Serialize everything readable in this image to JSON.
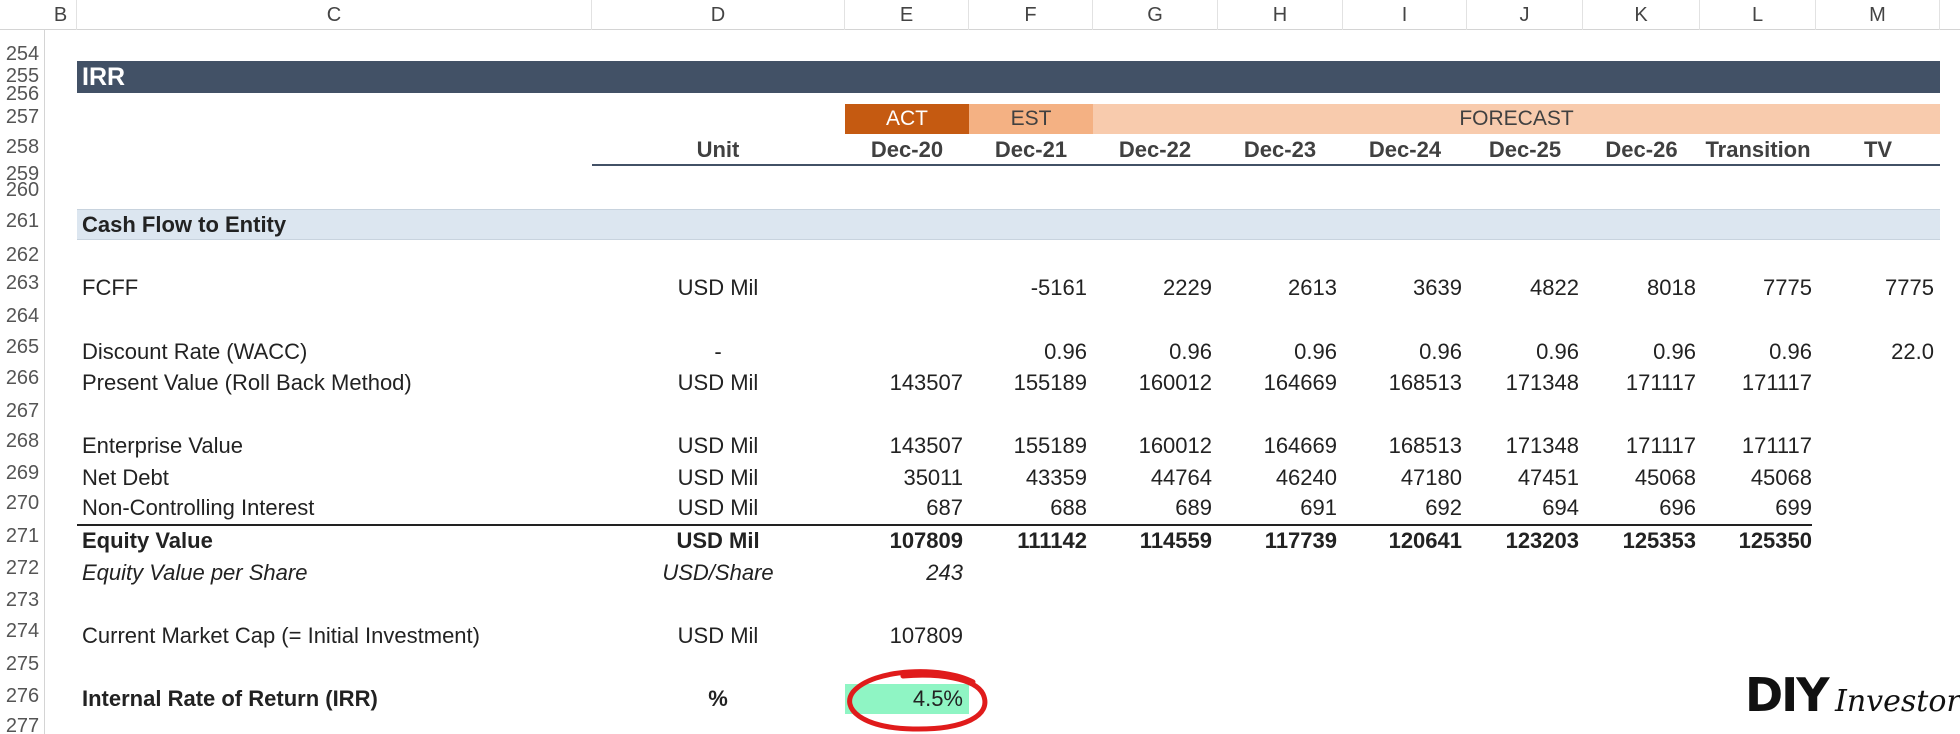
{
  "columns": [
    "B",
    "C",
    "D",
    "E",
    "F",
    "G",
    "H",
    "I",
    "J",
    "K",
    "L",
    "M"
  ],
  "rows": [
    "254",
    "255",
    "256",
    "257",
    "258",
    "259",
    "260",
    "261",
    "262",
    "263",
    "264",
    "265",
    "266",
    "267",
    "268",
    "269",
    "270",
    "271",
    "272",
    "273",
    "274",
    "275",
    "276",
    "277"
  ],
  "title": "IRR",
  "periods": {
    "act": "ACT",
    "est": "EST",
    "forecast": "FORECAST"
  },
  "headers": [
    "Unit",
    "Dec-20",
    "Dec-21",
    "Dec-22",
    "Dec-23",
    "Dec-24",
    "Dec-25",
    "Dec-26",
    "Transition",
    "TV"
  ],
  "section": "Cash Flow to Entity",
  "data_rows": [
    {
      "label": "FCFF",
      "unit": "USD Mil",
      "values": [
        "",
        "-5161",
        "2229",
        "2613",
        "3639",
        "4822",
        "8018",
        "7775",
        "7775"
      ]
    },
    {
      "label": "Discount Rate (WACC)",
      "unit": "-",
      "values": [
        "",
        "0.96",
        "0.96",
        "0.96",
        "0.96",
        "0.96",
        "0.96",
        "0.96",
        "22.0"
      ]
    },
    {
      "label": "Present Value (Roll Back Method)",
      "unit": "USD Mil",
      "values": [
        "143507",
        "155189",
        "160012",
        "164669",
        "168513",
        "171348",
        "171117",
        "171117",
        ""
      ]
    },
    {
      "label": "Enterprise Value",
      "unit": "USD Mil",
      "values": [
        "143507",
        "155189",
        "160012",
        "164669",
        "168513",
        "171348",
        "171117",
        "171117",
        ""
      ]
    },
    {
      "label": "Net Debt",
      "unit": "USD Mil",
      "values": [
        "35011",
        "43359",
        "44764",
        "46240",
        "47180",
        "47451",
        "45068",
        "45068",
        ""
      ]
    },
    {
      "label": "Non-Controlling Interest",
      "unit": "USD Mil",
      "values": [
        "687",
        "688",
        "689",
        "691",
        "692",
        "694",
        "696",
        "699",
        ""
      ]
    },
    {
      "label": "Equity Value",
      "unit": "USD Mil",
      "values": [
        "107809",
        "111142",
        "114559",
        "117739",
        "120641",
        "123203",
        "125353",
        "125350",
        ""
      ]
    },
    {
      "label": "Equity Value per Share",
      "unit": "USD/Share",
      "values": [
        "243",
        "",
        "",
        "",
        "",
        "",
        "",
        "",
        ""
      ]
    },
    {
      "label": "Current Market Cap (= Initial Investment)",
      "unit": "USD Mil",
      "values": [
        "107809",
        "",
        "",
        "",
        "",
        "",
        "",
        "",
        ""
      ]
    },
    {
      "label": "Internal Rate of Return (IRR)",
      "unit": "%",
      "values": [
        "4.5%",
        "",
        "",
        "",
        "",
        "",
        "",
        "",
        ""
      ]
    }
  ],
  "logo": {
    "main": "DIY",
    "script": "Investor"
  },
  "colors": {
    "title_band": "#425166",
    "act": "#c55a11",
    "est": "#f4b183",
    "forecast": "#f8cbad",
    "section_band": "#dce6f0",
    "irr_fill": "#8ff5c4",
    "irr_circle": "#e01b1b"
  }
}
